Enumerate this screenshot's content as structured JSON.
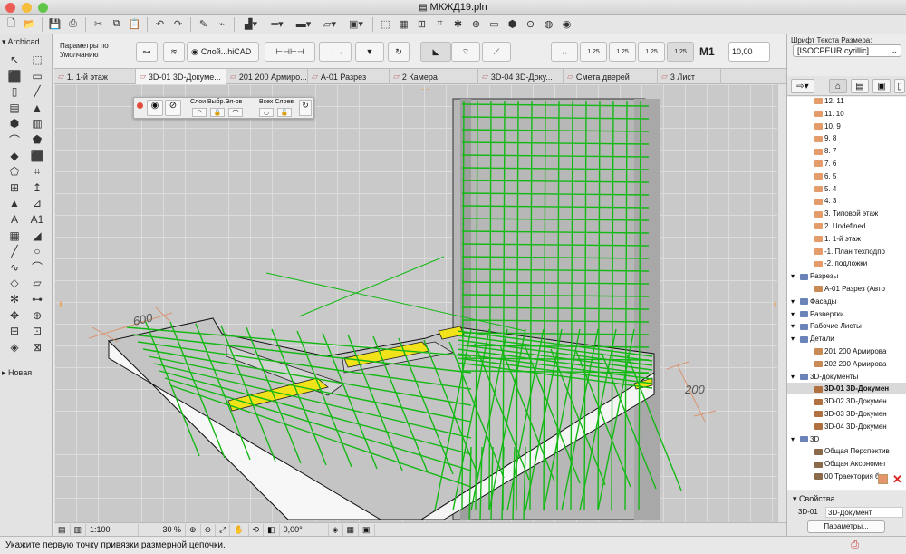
{
  "window": {
    "title": "МКЖД19.pln"
  },
  "toolbar": {
    "icons": [
      "new-file",
      "open",
      "save",
      "print",
      "cut",
      "copy",
      "paste",
      "undo",
      "redo",
      "pick",
      "inject",
      "layers",
      "pen",
      "fill",
      "marquee",
      "grid",
      "wall-icon",
      "zoom",
      "find",
      "3d",
      "render",
      "help"
    ]
  },
  "left_palette": {
    "header": "Archicad",
    "footer": "Новая",
    "tools": [
      "↖",
      "⬚",
      "⬛",
      "▭",
      "▯",
      "╱",
      "▤",
      "▲",
      "⬢",
      "▥",
      "⌒",
      "⬟",
      "◆",
      "⬛",
      "⬠",
      "⌗",
      "⊞",
      "↥",
      "▲",
      "⊿",
      "A",
      "A1",
      "▦",
      "◢",
      "╱",
      "○",
      "∿",
      "⌒",
      "◇",
      "▱",
      "✻",
      "⊶",
      "✥",
      "⊕",
      "⊟",
      "⊡",
      "◈",
      "⊠"
    ]
  },
  "infobox": {
    "label": "Параметры по\nУмолчанию",
    "layer": "Слой...hiCAD",
    "scales": [
      "1.25",
      "1.25",
      "1.25",
      "1.25"
    ],
    "font_label": "M1",
    "font_size": "10,00"
  },
  "tabs": [
    {
      "label": "1. 1-й этаж",
      "active": false
    },
    {
      "label": "3D-01 3D-Докуме...",
      "active": true
    },
    {
      "label": "201 200 Армиро...",
      "active": false
    },
    {
      "label": "A-01 Разрез",
      "active": false
    },
    {
      "label": "2 Камера",
      "active": false
    },
    {
      "label": "3D-04 3D-Доку...",
      "active": false
    },
    {
      "label": "Смета дверей",
      "active": false
    },
    {
      "label": "3 Лист",
      "active": false
    }
  ],
  "quick_palette": {
    "layers_label": "Слои Выбр.Эл-ов",
    "all_layers_label": "Всех Слоев"
  },
  "dimensions": {
    "left": "600",
    "right": "200"
  },
  "bottombar": {
    "scale": "1:100",
    "zoom": "30 %",
    "angle": "0,00°"
  },
  "status": "Укажите первую точку привязки размерной цепочки.",
  "right_panel": {
    "font_label": "Шрифт Текста Размера:",
    "font_value": "[ISOCPEUR cyrillic]",
    "tree": [
      {
        "label": "12. 11",
        "indent": 2,
        "icon": "story"
      },
      {
        "label": "11. 10",
        "indent": 2,
        "icon": "story"
      },
      {
        "label": "10. 9",
        "indent": 2,
        "icon": "story"
      },
      {
        "label": "9. 8",
        "indent": 2,
        "icon": "story"
      },
      {
        "label": "8. 7",
        "indent": 2,
        "icon": "story"
      },
      {
        "label": "7. 6",
        "indent": 2,
        "icon": "story"
      },
      {
        "label": "6. 5",
        "indent": 2,
        "icon": "story"
      },
      {
        "label": "5. 4",
        "indent": 2,
        "icon": "story"
      },
      {
        "label": "4. 3",
        "indent": 2,
        "icon": "story"
      },
      {
        "label": "3. Типовой этаж",
        "indent": 2,
        "icon": "story"
      },
      {
        "label": "2. Undefined",
        "indent": 2,
        "icon": "story"
      },
      {
        "label": "1. 1-й этаж",
        "indent": 2,
        "icon": "story"
      },
      {
        "label": "-1. План техподпо",
        "indent": 2,
        "icon": "story"
      },
      {
        "label": "-2. подложки",
        "indent": 2,
        "icon": "story"
      },
      {
        "label": "Разрезы",
        "indent": 1,
        "icon": "folder"
      },
      {
        "label": "A-01 Разрез (Авто",
        "indent": 2,
        "icon": "section"
      },
      {
        "label": "Фасады",
        "indent": 1,
        "icon": "folder"
      },
      {
        "label": "Развертки",
        "indent": 1,
        "icon": "folder"
      },
      {
        "label": "Рабочие Листы",
        "indent": 1,
        "icon": "folder"
      },
      {
        "label": "Детали",
        "indent": 1,
        "icon": "folder"
      },
      {
        "label": "201 200 Армирова",
        "indent": 2,
        "icon": "detail"
      },
      {
        "label": "202 200 Армирова",
        "indent": 2,
        "icon": "detail"
      },
      {
        "label": "3D-документы",
        "indent": 1,
        "icon": "folder"
      },
      {
        "label": "3D-01 3D-Докумен",
        "indent": 2,
        "icon": "doc3d",
        "selected": true
      },
      {
        "label": "3D-02 3D-Докумен",
        "indent": 2,
        "icon": "doc3d"
      },
      {
        "label": "3D-03 3D-Докумен",
        "indent": 2,
        "icon": "doc3d"
      },
      {
        "label": "3D-04 3D-Докумен",
        "indent": 2,
        "icon": "doc3d"
      },
      {
        "label": "3D",
        "indent": 1,
        "icon": "folder"
      },
      {
        "label": "Общая Перспектив",
        "indent": 2,
        "icon": "camera"
      },
      {
        "label": "Общая Аксономет",
        "indent": 2,
        "icon": "camera"
      },
      {
        "label": "00 Траектория без",
        "indent": 2,
        "icon": "camera"
      }
    ],
    "props_header": "Свойства",
    "props_id": "3D-01",
    "props_name": "3D-Документ",
    "props_button": "Параметры..."
  },
  "colors": {
    "rebar": "#14b814",
    "insulation": "#f2e21a",
    "concrete": "#bdbdbd",
    "dimension": "#d99570"
  }
}
